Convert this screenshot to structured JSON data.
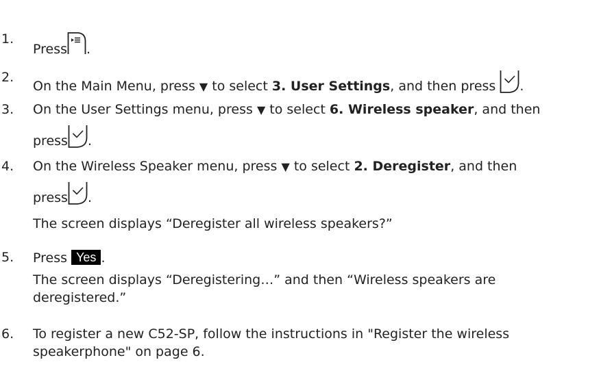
{
  "steps": [
    {
      "num": "1.",
      "text_before": "Press",
      "text_after": "."
    },
    {
      "num": "2.",
      "text_before": "On the Main Menu, press",
      "arrow": "▼",
      "text_mid": "to select",
      "bold": "3. User Settings",
      "text_after": ", and then press",
      "end": "."
    },
    {
      "num": "3.",
      "text_before": "On the User Settings menu, press",
      "arrow": "▼",
      "text_mid": "to select",
      "bold": "6. Wireless speaker",
      "text_after": ", and then",
      "line2": "press",
      "end": "."
    },
    {
      "num": "4.",
      "text_before": "On the Wireless Speaker menu, press",
      "arrow": "▼",
      "text_mid": "to select",
      "bold": "2. Deregister",
      "text_after": ", and then",
      "line2": "press",
      "end": ".",
      "note": "The screen displays “Deregister all wireless speakers?”"
    },
    {
      "num": "5.",
      "text_before": "Press",
      "softkey": "Yes",
      "end": ".",
      "note_line1": "The screen displays “Deregistering…” and then “Wireless speakers are",
      "note_line2": "deregistered.”"
    },
    {
      "num": "6.",
      "line1": "To register a new C52-SP, follow the instructions in \"Register the wireless",
      "line2": "speakerphone\" on page 6."
    }
  ],
  "icons": {
    "menu_key": "menu-key-icon",
    "ok_key": "ok-checkmark-key-icon",
    "down_arrow": "down-arrow-icon"
  }
}
